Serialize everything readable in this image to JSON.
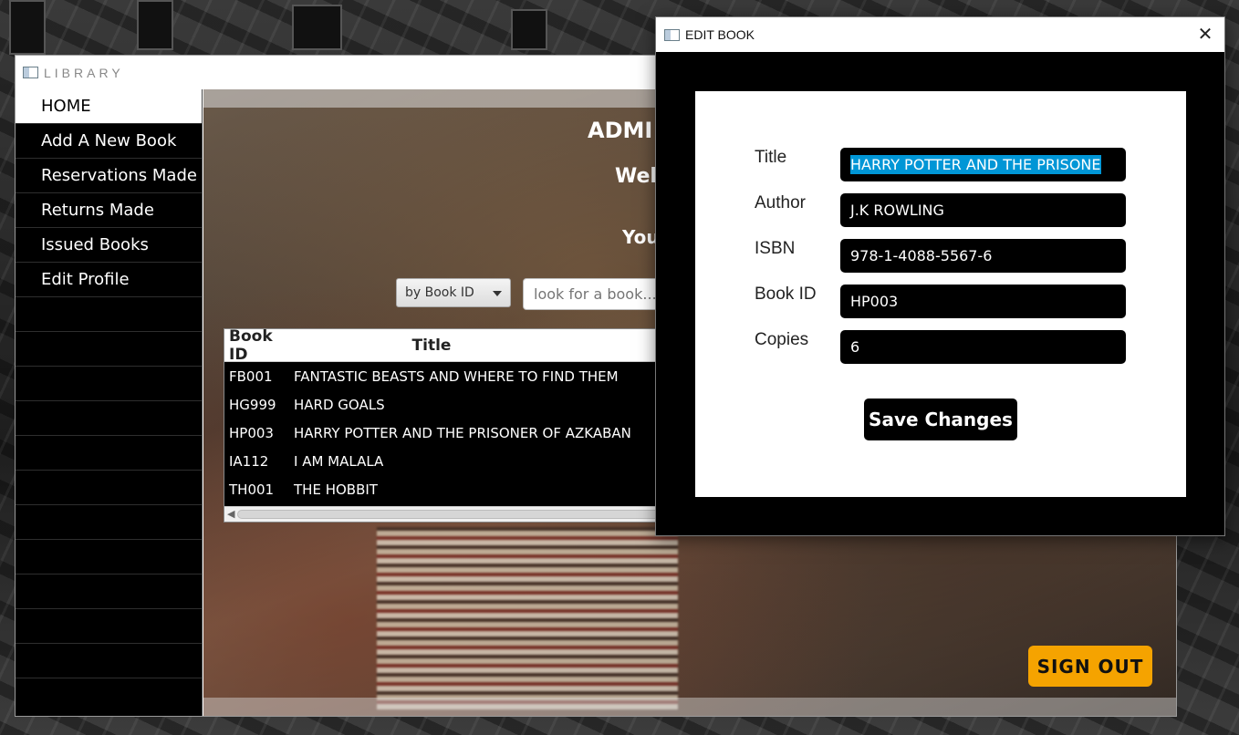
{
  "main_window": {
    "title": "LIBRARY",
    "sidebar": {
      "items": [
        {
          "label": "HOME",
          "active": true
        },
        {
          "label": "Add A New Book",
          "active": false
        },
        {
          "label": "Reservations Made",
          "active": false
        },
        {
          "label": "Returns Made",
          "active": false
        },
        {
          "label": "Issued Books",
          "active": false
        },
        {
          "label": "Edit Profile",
          "active": false
        }
      ]
    },
    "content": {
      "heading": "ADMI",
      "welcome": "Welc",
      "you_text": "You",
      "filter": {
        "selected": "by Book ID"
      },
      "search": {
        "placeholder": "look for a book..."
      },
      "table": {
        "columns": [
          "Book ID",
          "Title"
        ],
        "rows": [
          {
            "id": "FB001",
            "title": "FANTASTIC BEASTS AND WHERE TO FIND THEM"
          },
          {
            "id": "HG999",
            "title": "HARD GOALS"
          },
          {
            "id": "HP003",
            "title": "HARRY POTTER AND THE PRISONER OF AZKABAN"
          },
          {
            "id": "IA112",
            "title": "I AM MALALA"
          },
          {
            "id": "TH001",
            "title": "THE HOBBIT"
          }
        ]
      },
      "signout_label": "SIGN OUT"
    }
  },
  "edit_dialog": {
    "title": "EDIT BOOK",
    "close_glyph": "✕",
    "fields": [
      {
        "label": "Title",
        "value": "HARRY POTTER AND THE PRISONE",
        "selected": true
      },
      {
        "label": "Author",
        "value": "J.K ROWLING"
      },
      {
        "label": "ISBN",
        "value": "978-1-4088-5567-6"
      },
      {
        "label": "Book ID",
        "value": "HP003"
      },
      {
        "label": "Copies",
        "value": "6"
      }
    ],
    "save_label": "Save Changes"
  },
  "colors": {
    "signout_accent": "#f5a300",
    "selection_highlight": "#0096d6"
  }
}
